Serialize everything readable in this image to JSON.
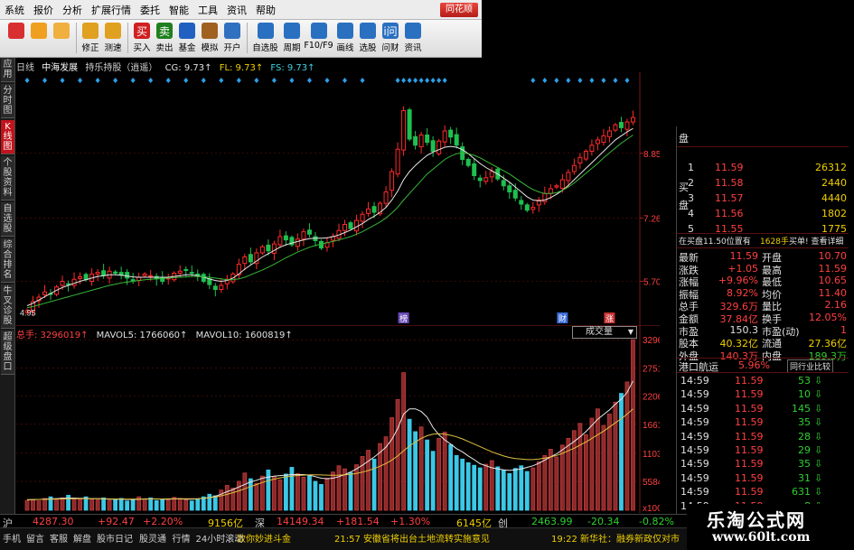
{
  "menu": {
    "items": [
      "系统",
      "报价",
      "分析",
      "扩展行情",
      "委托",
      "智能",
      "工具",
      "资讯",
      "帮助"
    ],
    "brand": "同花顺"
  },
  "toolbar": {
    "buttons": [
      {
        "label": "",
        "icon": "color-grid-icon",
        "color": "#d83030"
      },
      {
        "label": "",
        "icon": "back-arrow-icon",
        "color": "#f0a020"
      },
      {
        "label": "",
        "icon": "up-down-arrow-icon",
        "color": "#f0b040"
      },
      {
        "label": "修正",
        "icon": "refresh-icon",
        "color": "#e0a020"
      },
      {
        "label": "测速",
        "icon": "clock-icon",
        "color": "#e0a020"
      },
      {
        "label": "买入",
        "icon": "buy-icon",
        "color": "#d02020",
        "text": "买"
      },
      {
        "label": "卖出",
        "icon": "sell-icon",
        "color": "#208020",
        "text": "卖"
      },
      {
        "label": "基金",
        "icon": "fund-icon",
        "color": "#2060c0"
      },
      {
        "label": "模拟",
        "icon": "gavel-icon",
        "color": "#a06020"
      },
      {
        "label": "开户",
        "icon": "account-icon",
        "color": "#3070c0"
      },
      {
        "label": "自选股",
        "icon": "watchlist-icon",
        "color": "#2a70c0"
      },
      {
        "label": "周期",
        "icon": "period-icon",
        "color": "#2a70c0"
      },
      {
        "label": "F10/F9",
        "icon": "f10-icon",
        "color": "#2a70c0"
      },
      {
        "label": "画线",
        "icon": "pencil-icon",
        "color": "#2a70c0"
      },
      {
        "label": "选股",
        "icon": "screen-icon",
        "color": "#2a70c0"
      },
      {
        "label": "问财",
        "icon": "ask-icon",
        "color": "#2a70c0",
        "text": "i问"
      },
      {
        "label": "资讯",
        "icon": "news-icon",
        "color": "#2a70c0"
      }
    ]
  },
  "lefttabs": [
    "应用",
    "分时图",
    "K线图",
    "个股资料",
    "自选股",
    "综合排名",
    "牛叉诊股",
    "超级盘口"
  ],
  "chart_info": {
    "period": "日线",
    "stock": "中海发展",
    "mode": "持乐持股（逍遥）",
    "cg": "CG: 9.73↑",
    "fl": "FL: 9.73↑",
    "fs": "FS: 9.73↑"
  },
  "vol_info": {
    "total": "总手: 3296019↑",
    "mavol5": "MAVOL5: 1766060↑",
    "mavol10": "MAVOL10: 1600819↑",
    "select": "成交量"
  },
  "chart_data": [
    {
      "type": "candlestick",
      "title": "",
      "ylim": [
        4.8,
        10.4
      ],
      "yticks": [
        "8.85",
        "7.26",
        "5.70"
      ],
      "annotations": [
        "榜",
        "财",
        "涨"
      ],
      "low_label": "4.95",
      "close": [
        4.98,
        5.2,
        5.31,
        5.44,
        5.38,
        5.56,
        5.7,
        5.62,
        5.75,
        5.81,
        5.74,
        5.88,
        5.92,
        5.84,
        5.95,
        5.9,
        5.86,
        5.78,
        5.72,
        5.8,
        5.88,
        5.84,
        5.76,
        5.7,
        5.78,
        5.9,
        5.95,
        5.98,
        5.9,
        5.85,
        5.7,
        5.62,
        5.5,
        5.6,
        5.75,
        5.88,
        6.12,
        6.3,
        6.18,
        6.4,
        6.55,
        6.45,
        6.62,
        6.8,
        6.72,
        6.6,
        6.74,
        6.92,
        6.86,
        6.7,
        6.52,
        6.65,
        6.8,
        6.95,
        7.1,
        7.0,
        7.2,
        7.35,
        7.48,
        7.4,
        7.62,
        7.9,
        8.4,
        8.95,
        9.9,
        9.2,
        9.05,
        9.3,
        9.12,
        8.9,
        9.15,
        9.4,
        9.25,
        9.05,
        8.7,
        8.55,
        8.3,
        8.18,
        8.25,
        8.4,
        8.22,
        8.05,
        7.9,
        7.75,
        7.6,
        7.45,
        7.52,
        7.7,
        7.86,
        7.98,
        8.05,
        8.2,
        8.38,
        8.55,
        8.75,
        8.9,
        9.05,
        9.18,
        9.28,
        9.4,
        9.55,
        9.48,
        9.62,
        9.73
      ],
      "ma_short": [
        5.1,
        5.16,
        5.24,
        5.32,
        5.4,
        5.48,
        5.55,
        5.6,
        5.65,
        5.7,
        5.74,
        5.78,
        5.82,
        5.84,
        5.86,
        5.86,
        5.85,
        5.83,
        5.81,
        5.8,
        5.8,
        5.8,
        5.8,
        5.8,
        5.8,
        5.82,
        5.84,
        5.86,
        5.86,
        5.84,
        5.8,
        5.76,
        5.72,
        5.7,
        5.72,
        5.78,
        5.88,
        6.0,
        6.1,
        6.2,
        6.3,
        6.38,
        6.46,
        6.54,
        6.6,
        6.64,
        6.68,
        6.72,
        6.75,
        6.76,
        6.76,
        6.77,
        6.8,
        6.84,
        6.9,
        6.96,
        7.04,
        7.12,
        7.22,
        7.3,
        7.4,
        7.52,
        7.7,
        7.92,
        8.2,
        8.4,
        8.55,
        8.68,
        8.8,
        8.88,
        8.94,
        9.0,
        9.02,
        9.0,
        8.94,
        8.84,
        8.72,
        8.6,
        8.5,
        8.42,
        8.34,
        8.24,
        8.14,
        8.02,
        7.9,
        7.78,
        7.7,
        7.68,
        7.7,
        7.76,
        7.84,
        7.94,
        8.06,
        8.2,
        8.34,
        8.48,
        8.62,
        8.76,
        8.9,
        9.04,
        9.18,
        9.28,
        9.38,
        9.46
      ],
      "ma_long": [
        5.05,
        5.08,
        5.12,
        5.16,
        5.2,
        5.24,
        5.28,
        5.32,
        5.36,
        5.4,
        5.44,
        5.48,
        5.52,
        5.56,
        5.6,
        5.63,
        5.66,
        5.68,
        5.7,
        5.72,
        5.74,
        5.75,
        5.76,
        5.77,
        5.78,
        5.79,
        5.8,
        5.81,
        5.82,
        5.82,
        5.81,
        5.8,
        5.78,
        5.76,
        5.74,
        5.74,
        5.76,
        5.8,
        5.86,
        5.92,
        5.98,
        6.05,
        6.12,
        6.2,
        6.28,
        6.35,
        6.42,
        6.48,
        6.54,
        6.58,
        6.62,
        6.65,
        6.68,
        6.72,
        6.76,
        6.8,
        6.86,
        6.92,
        7.0,
        7.08,
        7.16,
        7.26,
        7.38,
        7.52,
        7.7,
        7.86,
        8.02,
        8.18,
        8.34,
        8.46,
        8.58,
        8.7,
        8.78,
        8.84,
        8.86,
        8.84,
        8.8,
        8.74,
        8.66,
        8.58,
        8.5,
        8.42,
        8.34,
        8.24,
        8.14,
        8.04,
        7.96,
        7.9,
        7.86,
        7.86,
        7.88,
        7.94,
        8.02,
        8.12,
        8.24,
        8.36,
        8.48,
        8.6,
        8.74,
        8.86,
        8.98,
        9.1,
        9.2,
        9.3
      ]
    },
    {
      "type": "bar",
      "title": "",
      "ylim": [
        0,
        33000
      ],
      "yticks": [
        "32960",
        "27512",
        "22064",
        "16616",
        "11032",
        "5584",
        "x100"
      ],
      "values": [
        1900,
        2100,
        1800,
        2300,
        2600,
        2000,
        2400,
        2900,
        2300,
        2100,
        2600,
        2200,
        2000,
        2400,
        1900,
        2100,
        2300,
        1800,
        2000,
        2600,
        2200,
        2400,
        1900,
        2200,
        2100,
        2500,
        2300,
        2000,
        1800,
        2100,
        2600,
        3100,
        2800,
        3900,
        4800,
        4300,
        5600,
        7200,
        6100,
        5200,
        6600,
        7800,
        6500,
        5900,
        7000,
        8300,
        7100,
        6400,
        6800,
        5600,
        5000,
        6200,
        7400,
        8600,
        8000,
        7300,
        8800,
        10400,
        11600,
        9900,
        12900,
        14200,
        17900,
        21400,
        26600,
        17600,
        15200,
        16100,
        13600,
        11400,
        13900,
        15100,
        12700,
        10600,
        9900,
        9200,
        8700,
        8200,
        8900,
        9600,
        8400,
        7700,
        7100,
        8100,
        8600,
        7500,
        8200,
        9400,
        10600,
        11800,
        10300,
        12600,
        13900,
        15400,
        16800,
        14600,
        17800,
        19600,
        16400,
        18600,
        20900,
        22600,
        24800,
        32960
      ],
      "mavol5": [
        2000,
        2050,
        2100,
        2150,
        2200,
        2250,
        2300,
        2350,
        2350,
        2300,
        2300,
        2250,
        2250,
        2200,
        2150,
        2150,
        2150,
        2100,
        2100,
        2150,
        2200,
        2200,
        2200,
        2150,
        2150,
        2200,
        2200,
        2150,
        2150,
        2200,
        2300,
        2450,
        2700,
        3100,
        3600,
        4000,
        4500,
        5000,
        5500,
        5800,
        6200,
        6400,
        6600,
        6700,
        6800,
        6900,
        6900,
        6900,
        6800,
        6500,
        6200,
        6100,
        6200,
        6500,
        6900,
        7400,
        8000,
        8700,
        9500,
        10300,
        11200,
        12200,
        13700,
        15800,
        18600,
        19600,
        19600,
        19100,
        18000,
        16000,
        14600,
        13600,
        12800,
        11900,
        11300,
        10500,
        9800,
        9000,
        8600,
        8200,
        8000,
        7800,
        7700,
        7800,
        8000,
        8300,
        8600,
        9100,
        9700,
        10300,
        10900,
        11700,
        12500,
        13300,
        14200,
        15200,
        16400,
        17600,
        18500,
        19400,
        20500,
        21500,
        22800,
        25000
      ],
      "mavol10": [
        2050,
        2070,
        2090,
        2110,
        2130,
        2160,
        2190,
        2220,
        2240,
        2250,
        2250,
        2240,
        2230,
        2220,
        2200,
        2190,
        2180,
        2170,
        2160,
        2160,
        2170,
        2180,
        2190,
        2190,
        2200,
        2210,
        2220,
        2230,
        2240,
        2260,
        2320,
        2420,
        2580,
        2800,
        3080,
        3400,
        3760,
        4160,
        4580,
        4980,
        5380,
        5720,
        6020,
        6260,
        6460,
        6620,
        6720,
        6800,
        6840,
        6840,
        6820,
        6800,
        6780,
        6800,
        6860,
        6960,
        7120,
        7360,
        7680,
        8060,
        8520,
        9040,
        9700,
        10500,
        11500,
        12400,
        13200,
        13900,
        14400,
        14700,
        14800,
        14700,
        14500,
        14200,
        13800,
        13300,
        12800,
        12300,
        11800,
        11300,
        10900,
        10500,
        10200,
        10000,
        9900,
        9800,
        9800,
        9900,
        10100,
        10300,
        10600,
        11000,
        11500,
        12000,
        12600,
        13200,
        13900,
        14600,
        15300,
        16100,
        16900,
        17700,
        18600,
        19600
      ]
    }
  ],
  "quote": {
    "sell_label": "盘",
    "sell": [
      {
        "p": "",
        "v": ""
      },
      {
        "p": "",
        "v": ""
      }
    ],
    "buy_label": "买盘",
    "buy": [
      {
        "n": "1",
        "p": "11.59",
        "v": "26312"
      },
      {
        "n": "2",
        "p": "11.58",
        "v": "2440"
      },
      {
        "n": "3",
        "p": "11.57",
        "v": "4440"
      },
      {
        "n": "4",
        "p": "11.56",
        "v": "1802"
      },
      {
        "n": "5",
        "p": "11.55",
        "v": "1775"
      }
    ],
    "position": "在买盘11.50位置有",
    "position_vol": "1628手",
    "position_link": "买单! 查看详细",
    "rows": [
      {
        "l1": "最新",
        "v1": "11.59",
        "l2": "开盘",
        "v2": "10.70"
      },
      {
        "l1": "涨跌",
        "v1": "+1.05",
        "l2": "最高",
        "v2": "11.59"
      },
      {
        "l1": "涨幅",
        "v1": "+9.96%",
        "l2": "最低",
        "v2": "10.65"
      },
      {
        "l1": "振幅",
        "v1": "8.92%",
        "l2": "均价",
        "v2": "11.40"
      },
      {
        "l1": "总手",
        "v1": "329.6万",
        "l2": "量比",
        "v2": "2.16"
      },
      {
        "l1": "金额",
        "v1": "37.84亿",
        "l2": "换手",
        "v2": "12.05%"
      },
      {
        "l1": "市盈",
        "v1": "150.3",
        "l2": "市盈(动)",
        "v2": "1"
      },
      {
        "l1": "股本",
        "v1": "40.32亿",
        "l2": "流通",
        "v2": "27.36亿"
      },
      {
        "l1": "外盘",
        "v1": "140.3万",
        "l2": "内盘",
        "v2": "189.3万"
      }
    ],
    "sector": "港口航运",
    "sector_pct": "5.96%",
    "sector_btn": "同行业比较",
    "ticks": [
      {
        "t": "14:59",
        "p": "11.59",
        "v": "53"
      },
      {
        "t": "14:59",
        "p": "11.59",
        "v": "10"
      },
      {
        "t": "14:59",
        "p": "11.59",
        "v": "145"
      },
      {
        "t": "14:59",
        "p": "11.59",
        "v": "35"
      },
      {
        "t": "14:59",
        "p": "11.59",
        "v": "28"
      },
      {
        "t": "14:59",
        "p": "11.59",
        "v": "29"
      },
      {
        "t": "14:59",
        "p": "11.59",
        "v": "35"
      },
      {
        "t": "14:59",
        "p": "11.59",
        "v": "31"
      },
      {
        "t": "14:59",
        "p": "11.59",
        "v": "631"
      },
      {
        "t": "14:59",
        "p": "11.59",
        "v": "8"
      }
    ]
  },
  "status": {
    "sh": "沪",
    "sh_idx": "4287.30",
    "sh_chg": "+92.47",
    "sh_pct": "+2.20%",
    "sh_amt": "9156亿",
    "sz": "深",
    "sz_idx": "14149.34",
    "sz_chg": "+181.54",
    "sz_pct": "+1.30%",
    "sz_amt": "6145亿",
    "cy": "创",
    "cy_idx": "2463.99",
    "cy_chg": "-20.34",
    "cy_pct": "-0.82%"
  },
  "bottom": {
    "tabs": [
      "手机",
      "留言",
      "客服",
      "解盘",
      "股市日记",
      "股灵通",
      "行情",
      "24小时滚动"
    ],
    "news1": "致你妙进斗金",
    "news2": "21:57 安徽省将出台土地流转实施意见",
    "news3": "19:22 新华社：融券新政仅对市"
  },
  "watermark": {
    "line1": "乐淘公式网",
    "line2": "www.60lt.com"
  },
  "colors": {
    "up": "#ff3c3c",
    "down": "#3cc8e6",
    "down_candle": "#1ec050",
    "up_candle": "#ff2a2a",
    "gridline": "#6a1010",
    "text_red": "#ff4040",
    "text_green": "#30d030",
    "text_yellow": "#f0d000",
    "text_cyan": "#40d0e0"
  }
}
